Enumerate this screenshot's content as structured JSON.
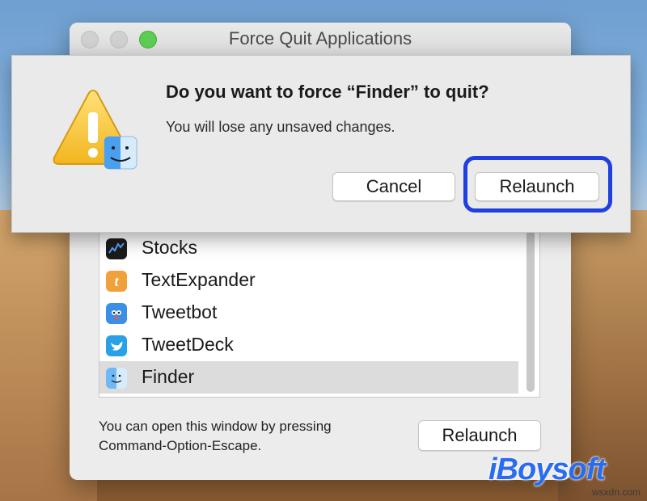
{
  "window": {
    "title": "Force Quit Applications"
  },
  "apps": [
    {
      "name": "Stocks",
      "icon": "stocks-icon"
    },
    {
      "name": "TextExpander",
      "icon": "textexpander-icon"
    },
    {
      "name": "Tweetbot",
      "icon": "tweetbot-icon"
    },
    {
      "name": "TweetDeck",
      "icon": "tweetdeck-icon"
    },
    {
      "name": "Finder",
      "icon": "finder-icon",
      "selected": true
    }
  ],
  "hint": {
    "line1": "You can open this window by pressing",
    "line2": "Command-Option-Escape."
  },
  "bottom_button": "Relaunch",
  "sheet": {
    "title": "Do you want to force “Finder” to quit?",
    "message": "You will lose any unsaved changes.",
    "cancel_label": "Cancel",
    "relaunch_label": "Relaunch"
  },
  "watermark": "iBoysoft",
  "site_mark": "wsxdn.com",
  "colors": {
    "highlight": "#1f3fe0",
    "zoom_light": "#5ccd52",
    "watermark": "#2a6cf0"
  }
}
